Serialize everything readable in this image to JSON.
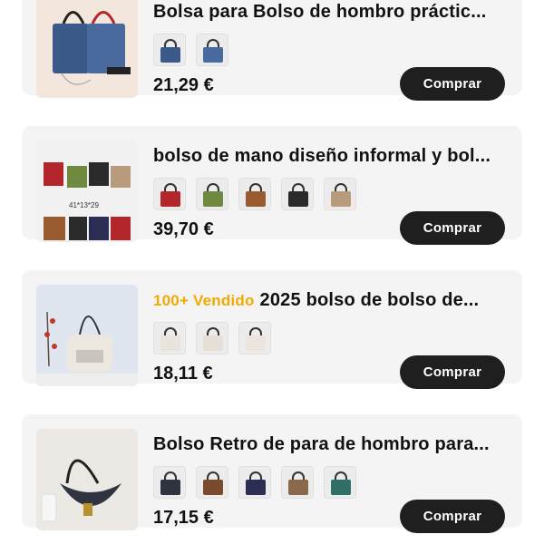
{
  "products": [
    {
      "title": "Bolsa para Bolso de hombro práctic...",
      "badge": "",
      "price": "21,29 €",
      "button": "Comprar",
      "swatch_colors": [
        "#3b5a8a",
        "#4a6a9e"
      ]
    },
    {
      "title": "bolso de mano diseño informal y bol...",
      "badge": "",
      "price": "39,70 €",
      "button": "Comprar",
      "swatch_colors": [
        "#b3262c",
        "#6f8a3e",
        "#9a5a30",
        "#2a2a2a",
        "#b89a7c"
      ]
    },
    {
      "title": "2025 bolso de bolso de...",
      "badge": "100+ Vendido",
      "price": "18,11 €",
      "button": "Comprar",
      "swatch_colors": [
        "#e9e4dc",
        "#e6e0d6",
        "#ebe5dd"
      ]
    },
    {
      "title": "Bolso Retro de para de hombro para...",
      "badge": "",
      "price": "17,15 €",
      "button": "Comprar",
      "swatch_colors": [
        "#2f3440",
        "#7a4a2e",
        "#2b2e52",
        "#8a6a4a",
        "#2f6f66"
      ]
    }
  ],
  "thumb_label_2": "41*13*29"
}
